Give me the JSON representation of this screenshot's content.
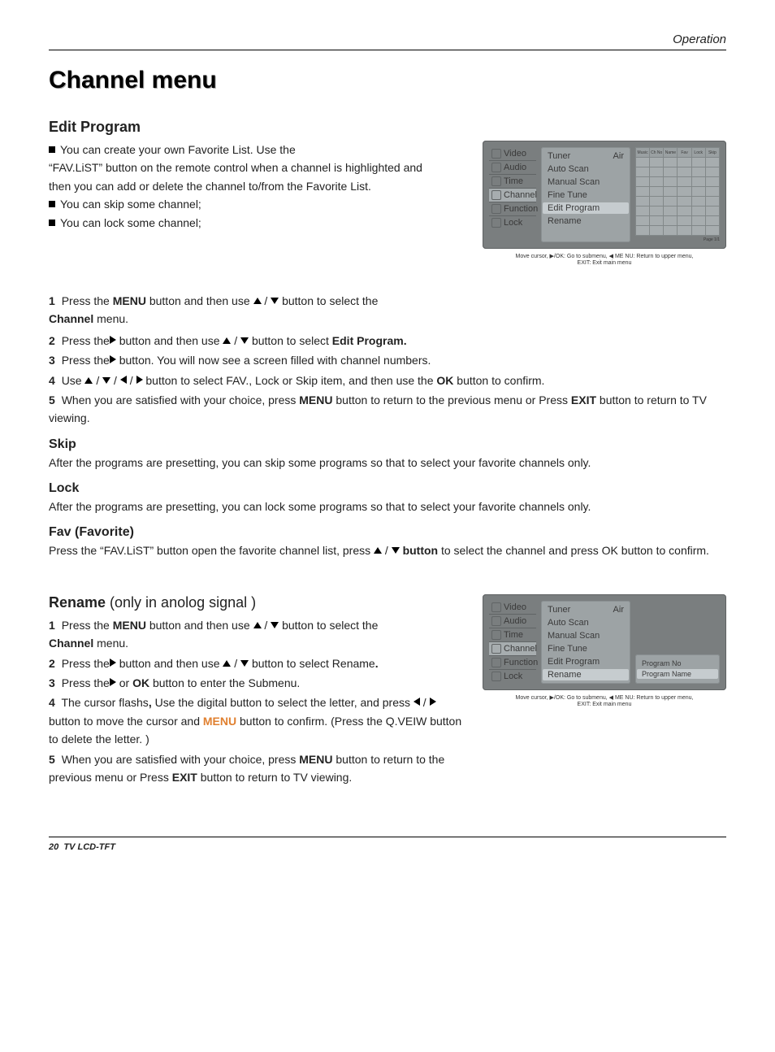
{
  "header": {
    "section": "Operation"
  },
  "title": "Channel menu",
  "editProgram": {
    "heading": "Edit Program",
    "intro_line1": "You can create your own Favorite List. Use the",
    "intro_line2": "“FAV.LiST” button on the remote control when a channel is highlighted and",
    "intro_line3": "then you can add or delete the channel to/from the Favorite List.",
    "bullet_skip": "You can skip some channel;",
    "bullet_lock": "You can lock some channel;",
    "step1_a": "Press the ",
    "step1_menu": "MENU",
    "step1_b": " button and then use ",
    "step1_c": " button to select the ",
    "step1_channel_label": "Channel",
    "step1_d": " menu.",
    "step2_a": "Press the",
    "step2_b": "button and then use ",
    "step2_c": " button to select ",
    "step2_target": "Edit Program.",
    "step3": "Press the",
    "step3_b": "button. You will now see a screen filled with channel numbers.",
    "step4_a": "Use ",
    "step4_b": " button to select FAV., Lock or Skip item,  and then use the ",
    "step4_ok": "OK",
    "step4_c": " button to confirm.",
    "step5_a": "When you are satisfied with your choice,  press ",
    "step5_menu": "MENU",
    "step5_b": " button to return to the previous menu or Press ",
    "step5_exit": "EXIT",
    "step5_c": " button to return to TV viewing."
  },
  "skip": {
    "heading": "Skip",
    "body": "After the programs are presetting, you can skip some programs so that to select your  favorite channels only."
  },
  "lock": {
    "heading": "Lock",
    "body": "After the programs are presetting, you can lock some programs so that to select your  favorite channels only."
  },
  "fav": {
    "heading": "Fav (Favorite)",
    "body_a": "Press the “FAV.LiST” button open the favorite channel list, press ",
    "body_btn": "button",
    "body_b": " to select the channel and press OK button to confirm."
  },
  "rename": {
    "heading_strong": "Rename",
    "heading_rest": " (only in anolog signal )",
    "step1_a": "Press the ",
    "step1_menu": "MENU",
    "step1_b": " button and then use ",
    "step1_c": " button to select the ",
    "step1_channel": "Channel",
    "step1_d": " menu.",
    "step2_a": "Press the",
    "step2_b": "button and then use ",
    "step2_c": " button to select Rename",
    "step2_d": ".",
    "step3_a": "Press the",
    "step3_b": "or ",
    "step3_ok": "OK",
    "step3_c": " button to enter the Submenu.",
    "step4_a": "The cursor flashs",
    "step4_comma": ", ",
    "step4_b": "Use the digital button to select the letter, and press ",
    "step4_c": "button to move the cursor and ",
    "step4_menu": "MENU",
    "step4_d": " button to confirm. (Press  the Q.VEIW button to delete the letter. )",
    "step5_a": "When you are satisfied with your choice,  press ",
    "step5_menu": "MENU",
    "step5_b": " button to return to the previous menu or Press ",
    "step5_exit": "EXIT",
    "step5_c": " button to return to TV viewing."
  },
  "osd": {
    "tabs": [
      "Video",
      "Audio",
      "Time",
      "Channel",
      "Function",
      "Lock"
    ],
    "mid_items": [
      {
        "label": "Tuner",
        "value": "Air"
      },
      {
        "label": "Auto Scan"
      },
      {
        "label": "Manual Scan"
      },
      {
        "label": "Fine Tune"
      },
      {
        "label": "Edit Program"
      },
      {
        "label": "Rename"
      }
    ],
    "grid_headers": [
      "Music",
      "Ch No",
      "Name",
      "Fav",
      "Lock",
      "Skip"
    ],
    "page_indicator": "Page 1/1",
    "program_no": "Program No",
    "program_name": "Program Name",
    "hint_line1": "Move cursor,  ▶/OK: Go to submenu,  ◀ ME NU: Return to upper menu,",
    "hint_line2": "EXIT: Exit main menu"
  },
  "footer": {
    "page": "20",
    "label": "TV LCD-TFT"
  }
}
